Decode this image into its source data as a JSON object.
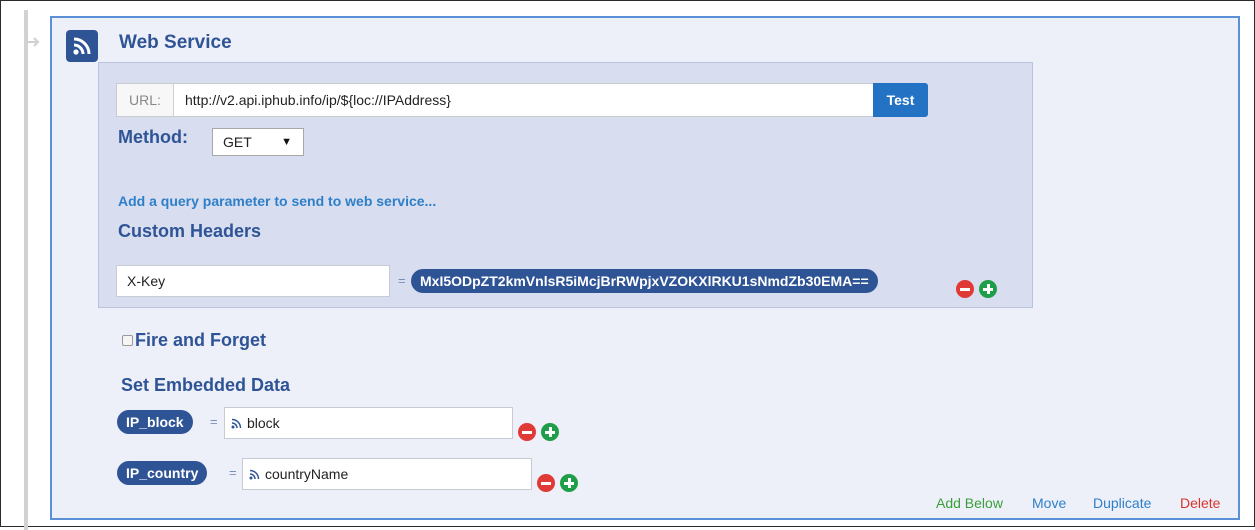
{
  "block": {
    "title": "Web Service",
    "icon": "rss-feed-icon"
  },
  "request": {
    "url_label": "URL:",
    "url_value": "http://v2.api.iphub.info/ip/${loc://IPAddress}",
    "test_label": "Test",
    "method_label": "Method:",
    "method_value": "GET",
    "add_param_link": "Add a query parameter to send to web service..."
  },
  "custom_headers": {
    "title": "Custom Headers",
    "items": [
      {
        "key": "X-Key",
        "eq": "=",
        "value": "MxI5ODpZT2kmVnlsR5iMcjBrRWpjxVZOKXlRKU1sNmdZb30EMA=="
      }
    ]
  },
  "fire_and_forget": {
    "label": "Fire and Forget",
    "checked": false
  },
  "embedded_data": {
    "title": "Set Embedded Data",
    "items": [
      {
        "field": "IP_block",
        "eq": "=",
        "value": "block"
      },
      {
        "field": "IP_country",
        "eq": "=",
        "value": "countryName"
      }
    ]
  },
  "actions": {
    "add_below": "Add Below",
    "move": "Move",
    "duplicate": "Duplicate",
    "delete": "Delete"
  },
  "colors": {
    "accent": "#2f5496",
    "link": "#2e7fc9",
    "button": "#2372c4",
    "panel": "#d8deef",
    "add_below": "#3a9e3a",
    "delete": "#d9342b",
    "minus": "#e03a36",
    "plus": "#1e9e48"
  }
}
